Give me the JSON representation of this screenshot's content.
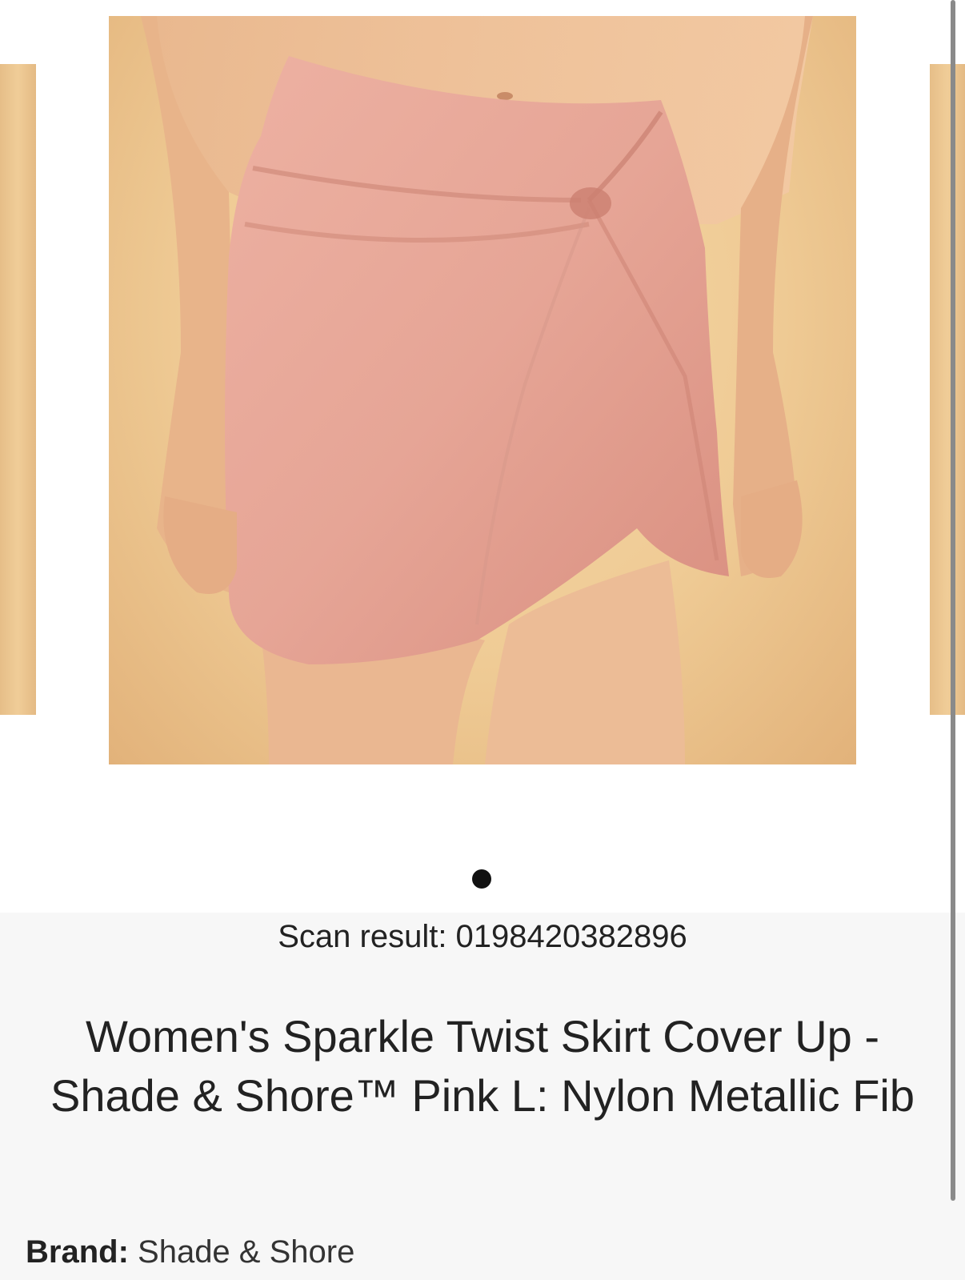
{
  "product": {
    "scan_result": "Scan result: 0198420382896",
    "title": "Women's Sparkle Twist Skirt Cover Up - Shade & Shore™ Pink L: Nylon Metallic Fib",
    "brand_label": "Brand:",
    "brand_value": "Shade & Shore"
  },
  "carousel": {
    "page_indicator_icon": "dot-icon",
    "image_subject": "pink twist skirt product photo"
  },
  "colors": {
    "background": "#ffffff",
    "info_panel": "#f7f7f7",
    "text": "#222222",
    "skirt": "#e6a596",
    "backdrop": "#efcb95"
  }
}
